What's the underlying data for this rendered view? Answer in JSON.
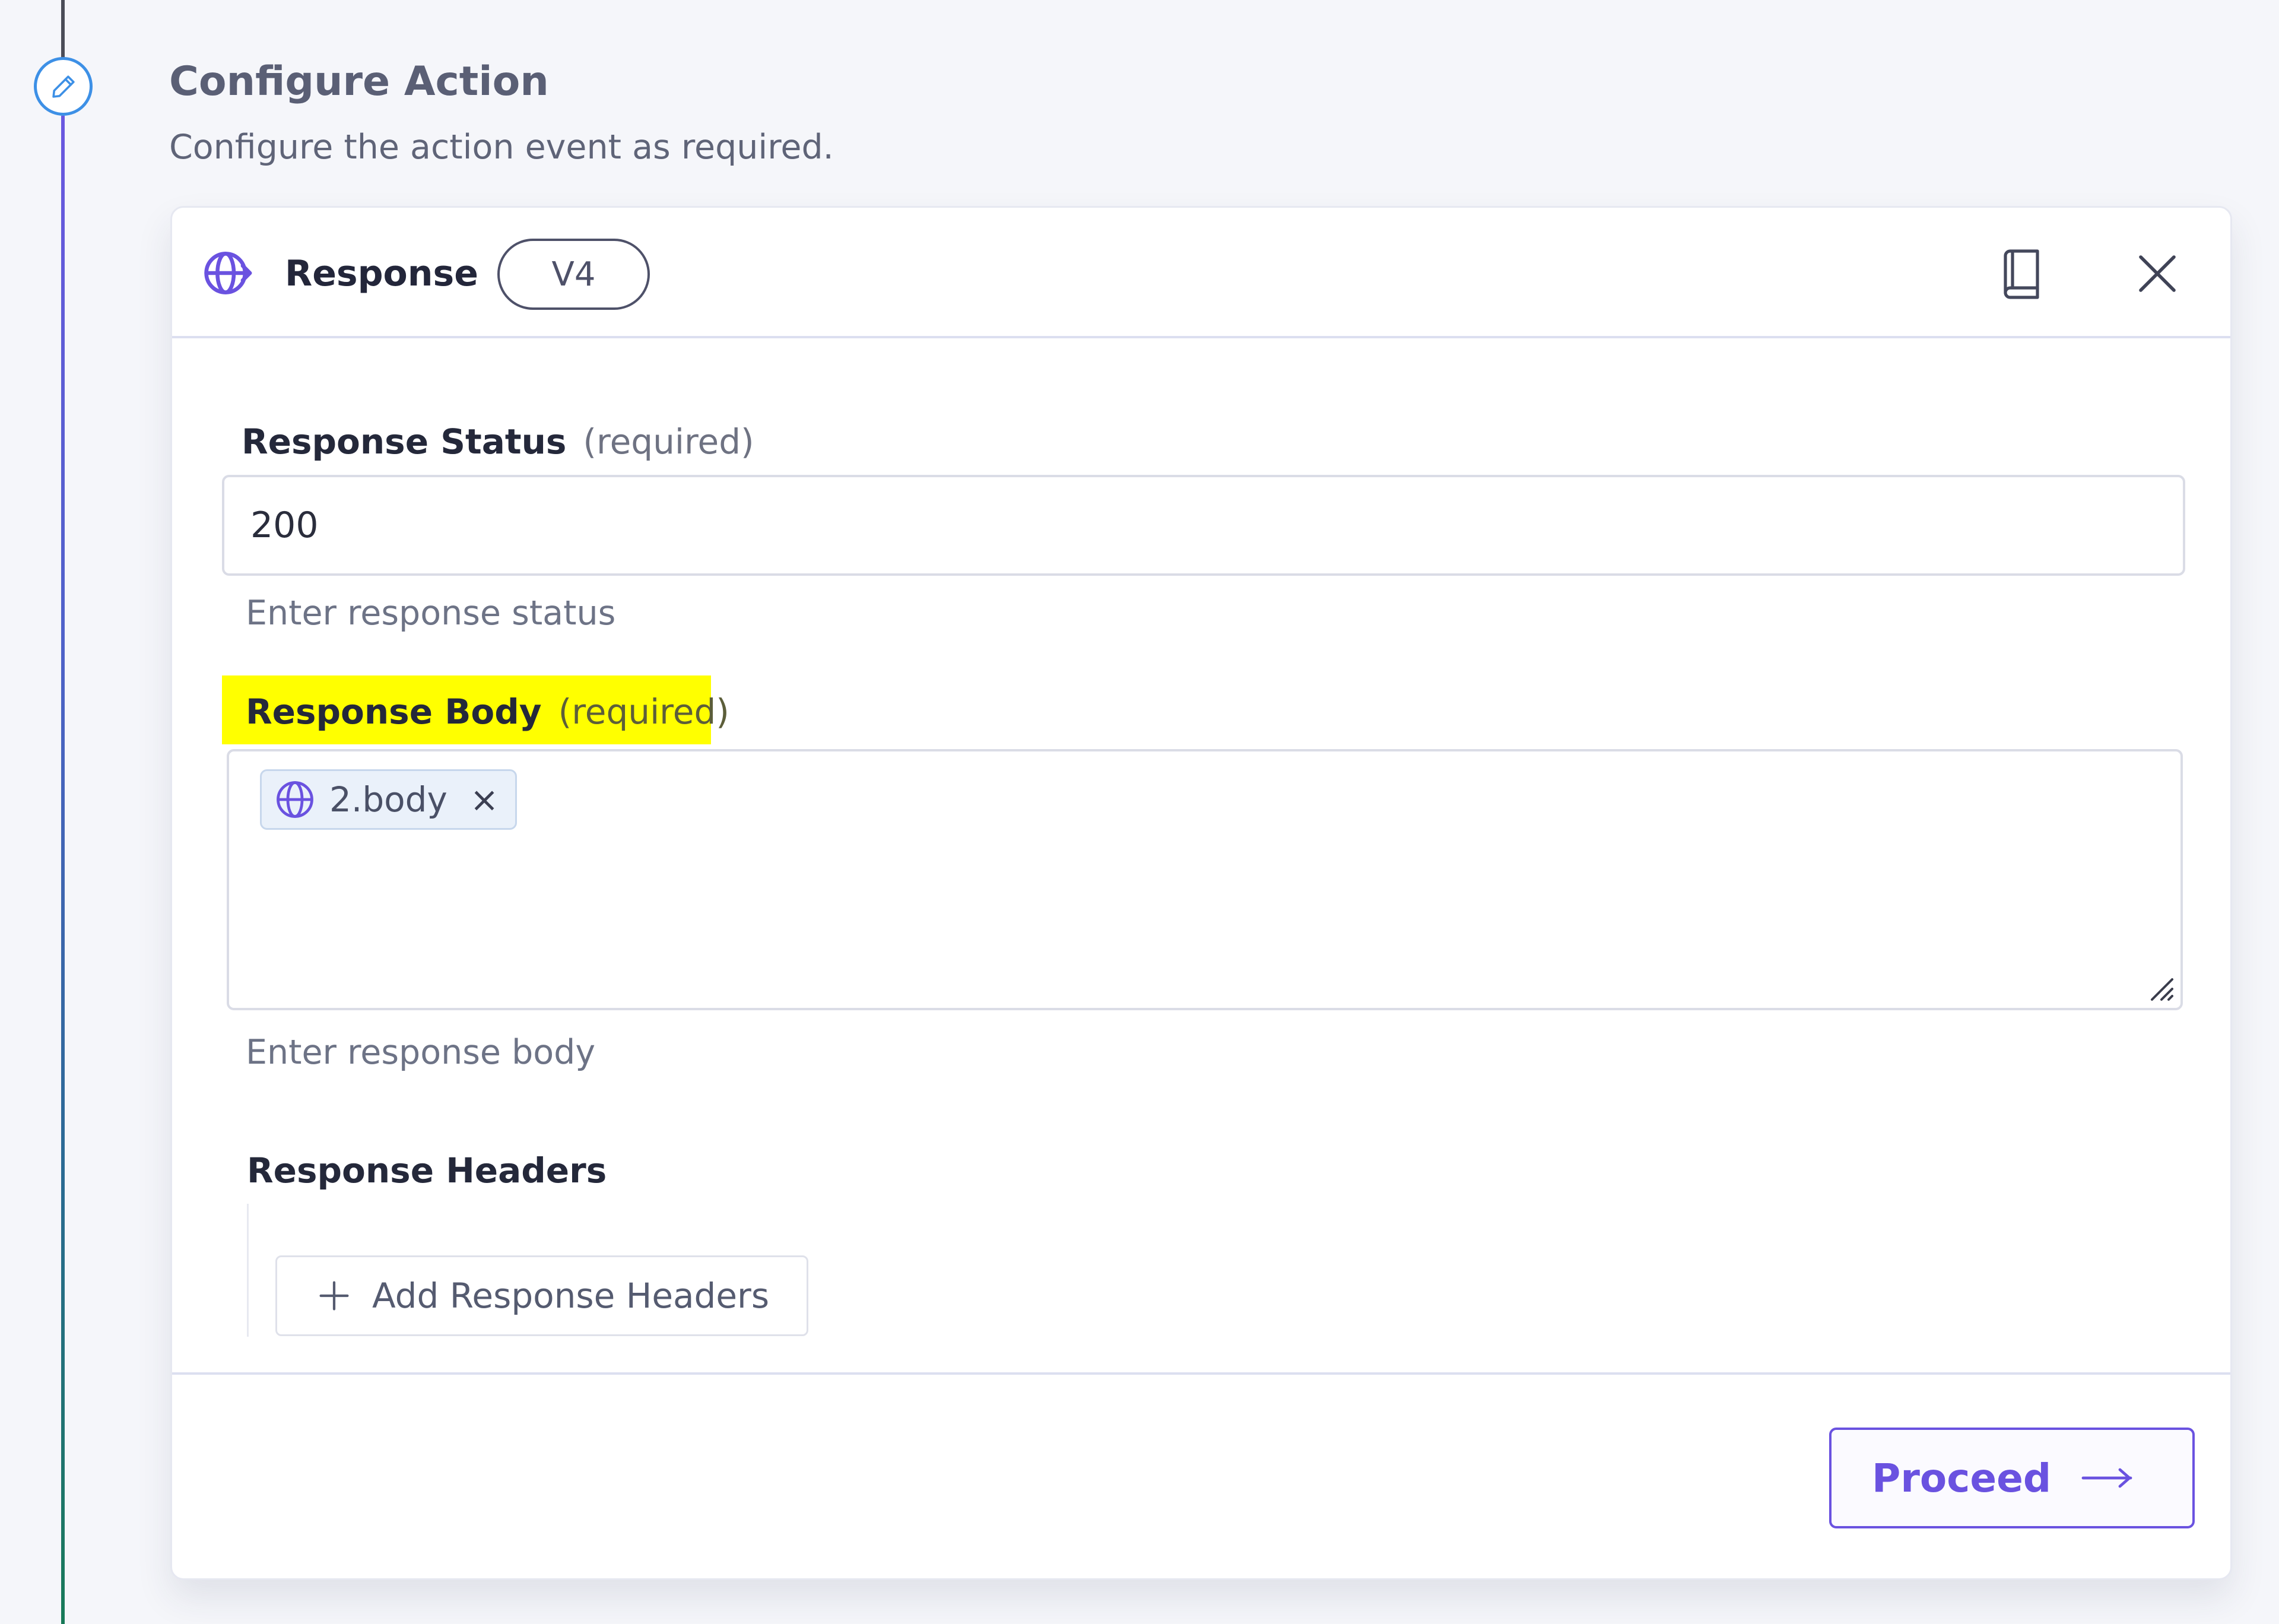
{
  "section": {
    "title": "Configure Action",
    "subtitle": "Configure the action event as required.",
    "step_icon": "pencil-icon"
  },
  "card": {
    "app_icon": "globe-arrow-icon",
    "title": "Response",
    "version": "V4",
    "docs_icon": "book-icon",
    "close_icon": "close-icon"
  },
  "fields": {
    "status": {
      "label": "Response Status",
      "required": "(required)",
      "value": "200",
      "hint": "Enter response status"
    },
    "body": {
      "label": "Response Body",
      "required": "(required)",
      "chip": "2.body",
      "chip_icon": "globe-icon",
      "chip_remove": "×",
      "hint": "Enter response body",
      "highlight_color": "#ffff00"
    },
    "headers": {
      "label": "Response Headers",
      "add_button": "Add Response Headers",
      "add_icon": "plus-icon"
    }
  },
  "footer": {
    "proceed": "Proceed",
    "proceed_icon": "arrow-right-icon"
  },
  "colors": {
    "accent": "#6a52e0",
    "step_blue": "#3d90e6",
    "highlight": "#ffff00"
  }
}
